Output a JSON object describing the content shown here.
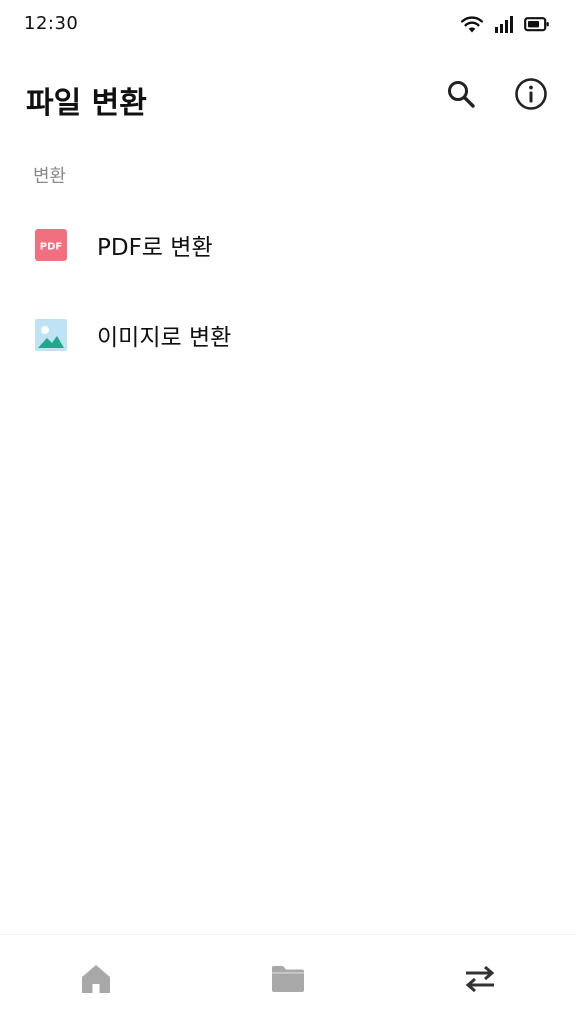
{
  "status_bar": {
    "time": "12:30",
    "icons": [
      "wifi-icon",
      "signal-icon",
      "battery-icon"
    ]
  },
  "app_bar": {
    "title": "파일 변환",
    "actions": [
      "search-icon",
      "info-icon"
    ]
  },
  "section": {
    "header": "변환"
  },
  "items": [
    {
      "label": "PDF로 변환",
      "icon": "pdf-icon",
      "icon_text": "PDF",
      "icon_color": "#f0707f"
    },
    {
      "label": "이미지로 변환",
      "icon": "image-icon",
      "icon_color": "#bfe2f4"
    }
  ],
  "bottom_nav": {
    "items": [
      "home-icon",
      "folder-icon",
      "swap-icon"
    ],
    "active": "swap-icon"
  },
  "colors": {
    "text_primary": "#111111",
    "text_secondary": "#8a8a8a",
    "nav_inactive": "#a8a8a8",
    "nav_active": "#333333"
  }
}
